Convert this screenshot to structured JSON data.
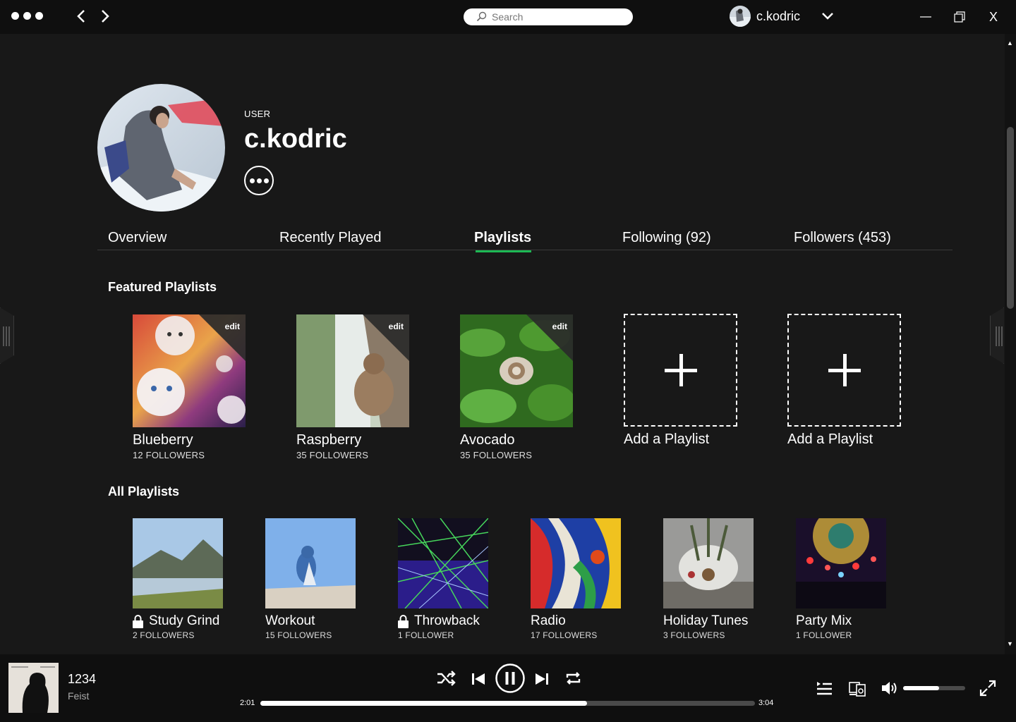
{
  "titlebar": {
    "search_placeholder": "Search",
    "username": "c.kodric",
    "close_label": "X"
  },
  "profile": {
    "type_label": "USER",
    "name": "c.kodric"
  },
  "tabs": [
    {
      "label": "Overview"
    },
    {
      "label": "Recently Played"
    },
    {
      "label": "Playlists",
      "active": true
    },
    {
      "label": "Following (92)"
    },
    {
      "label": "Followers (453)"
    }
  ],
  "featured": {
    "title": "Featured Playlists",
    "edit_label": "edit",
    "items": [
      {
        "name": "Blueberry",
        "followers": "12 FOLLOWERS"
      },
      {
        "name": "Raspberry",
        "followers": "35 FOLLOWERS"
      },
      {
        "name": "Avocado",
        "followers": "35 FOLLOWERS"
      }
    ],
    "add_label": "Add a Playlist"
  },
  "all": {
    "title": "All Playlists",
    "items": [
      {
        "name": "Study Grind",
        "followers": "2 FOLLOWERS",
        "locked": true
      },
      {
        "name": "Workout",
        "followers": "15 FOLLOWERS",
        "locked": false
      },
      {
        "name": "Throwback",
        "followers": "1 FOLLOWER",
        "locked": true
      },
      {
        "name": "Radio",
        "followers": "17 FOLLOWERS",
        "locked": false
      },
      {
        "name": "Holiday Tunes",
        "followers": "3 FOLLOWERS",
        "locked": false
      },
      {
        "name": "Party Mix",
        "followers": "1 FOLLOWER",
        "locked": false
      }
    ]
  },
  "player": {
    "track": "1234",
    "artist": "Feist",
    "elapsed": "2:01",
    "duration": "3:04",
    "progress_fraction": 0.66,
    "volume_fraction": 0.58
  },
  "colors": {
    "accent": "#1db954",
    "background": "#181818",
    "chrome": "#0f0f0f"
  }
}
